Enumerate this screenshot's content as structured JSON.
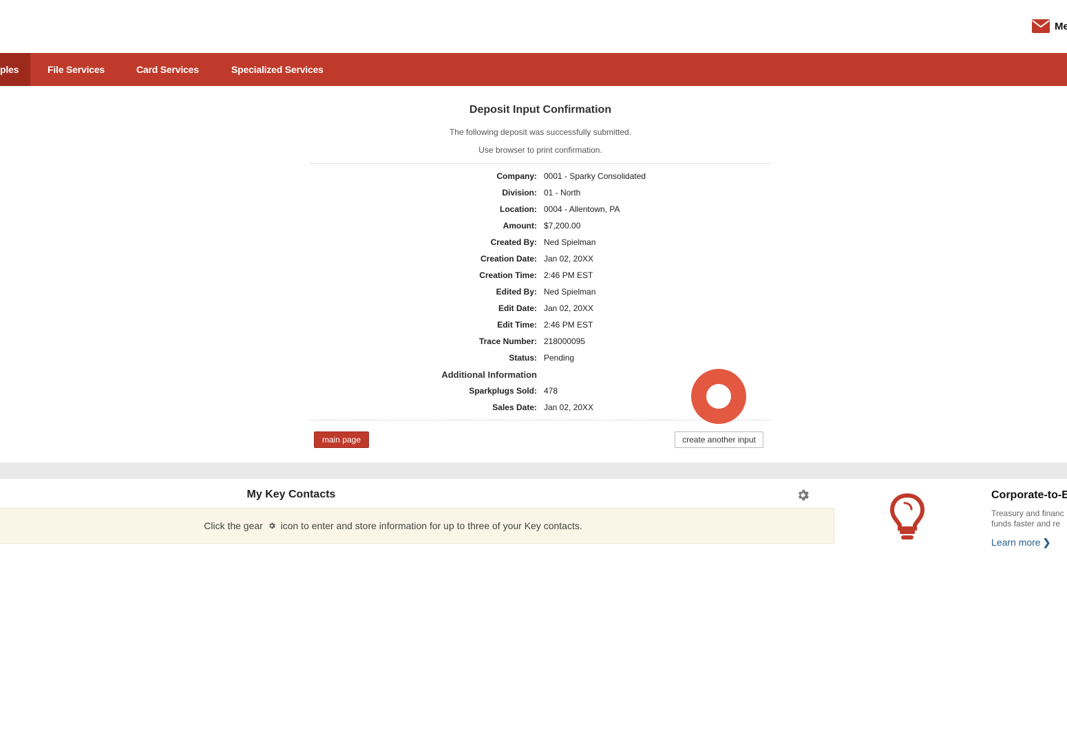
{
  "header": {
    "mail_label": "Me"
  },
  "nav": {
    "items": [
      {
        "label": "ples",
        "active": true
      },
      {
        "label": "File Services"
      },
      {
        "label": "Card Services"
      },
      {
        "label": "Specialized Services"
      }
    ]
  },
  "confirmation": {
    "title": "Deposit Input Confirmation",
    "message": "The following deposit was successfully submitted.",
    "print_hint": "Use browser to print confirmation.",
    "fields": [
      {
        "label": "Company:",
        "value": "0001 - Sparky Consolidated"
      },
      {
        "label": "Division:",
        "value": "01 - North"
      },
      {
        "label": "Location:",
        "value": "0004 - Allentown, PA"
      },
      {
        "label": "Amount:",
        "value": "$7,200.00"
      },
      {
        "label": "Created By:",
        "value": "Ned Spielman"
      },
      {
        "label": "Creation Date:",
        "value": "Jan 02, 20XX"
      },
      {
        "label": "Creation Time:",
        "value": "2:46 PM EST"
      },
      {
        "label": "Edited By:",
        "value": "Ned Spielman"
      },
      {
        "label": "Edit Date:",
        "value": "Jan 02, 20XX"
      },
      {
        "label": "Edit Time:",
        "value": "2:46 PM EST"
      },
      {
        "label": "Trace Number:",
        "value": "218000095"
      },
      {
        "label": "Status:",
        "value": "Pending"
      }
    ],
    "additional_heading": "Additional Information",
    "additional_fields": [
      {
        "label": "Sparkplugs Sold:",
        "value": "478"
      },
      {
        "label": "Sales Date:",
        "value": "Jan 02, 20XX"
      }
    ],
    "main_page_label": "main page",
    "create_another_label": "create another input"
  },
  "contacts": {
    "title": "My Key Contacts",
    "message_before": "Click the gear",
    "message_after": "icon to enter and store information for up to three of your Key contacts."
  },
  "promo": {
    "title": "Corporate-to-B",
    "line1": "Treasury and financ",
    "line2": "funds faster and re",
    "learn_more": "Learn more"
  },
  "colors": {
    "brand_red": "#bf3a2b",
    "nav_active": "#9e2a1e",
    "click_marker": "#e35841",
    "link_blue": "#2a5f8f"
  }
}
